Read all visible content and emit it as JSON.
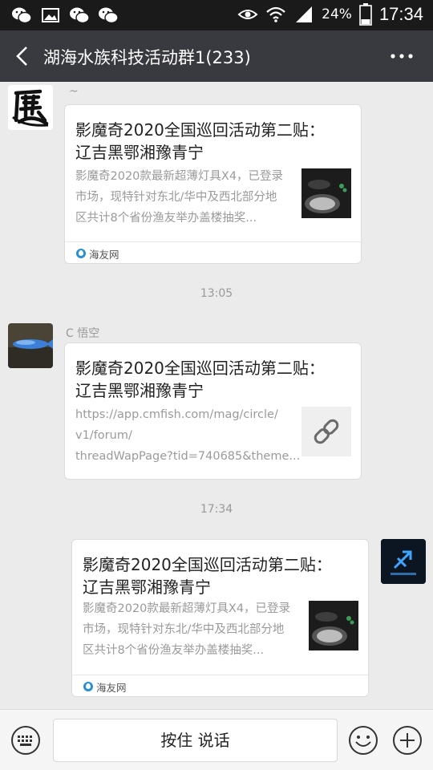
{
  "status_bar": {
    "battery": "24%",
    "time": "17:34",
    "left_icons": [
      "wechat-icon",
      "image-icon",
      "wechat-icon",
      "wechat-icon"
    ],
    "right_icons": [
      "eye-icon",
      "wifi-icon",
      "signal-icon",
      "battery-icon"
    ]
  },
  "header": {
    "title": "湖海水族科技活动群1(233)"
  },
  "messages": [
    {
      "sender": "~",
      "card": {
        "title_line1": "影魔奇2020全国巡回活动第二贴：",
        "title_line2": "辽吉黑鄂湘豫青宁",
        "desc_line1": "影魔奇2020款最新超薄灯具X4，已登录",
        "desc_line2": "市场，现特针对东北/华中及西北部分地",
        "desc_line3": "区共计8个省份渔友举办盖楼抽奖...",
        "source": "海友网"
      }
    },
    {
      "sender": "C 悟空",
      "card": {
        "title_line1": "影魔奇2020全国巡回活动第二贴：",
        "title_line2": "辽吉黑鄂湘豫青宁",
        "desc_line1": "https://app.cmfish.com/mag/circle/",
        "desc_line2": "v1/forum/",
        "desc_line3": "threadWapPage?tid=740685&theme..."
      }
    },
    {
      "sender": "",
      "card": {
        "title_line1": "影魔奇2020全国巡回活动第二贴：",
        "title_line2": "辽吉黑鄂湘豫青宁",
        "desc_line1": "影魔奇2020款最新超薄灯具X4，已登录",
        "desc_line2": "市场，现特针对东北/华中及西北部分地",
        "desc_line3": "区共计8个省份渔友举办盖楼抽奖...",
        "source": "海友网"
      }
    }
  ],
  "timestamps": [
    "13:05",
    "17:34"
  ],
  "input_bar": {
    "voice_label": "按住 说话"
  },
  "colors": {
    "status_bar_bg": "#1a1a1a",
    "header_bg": "#393a3f",
    "chat_bg": "#ebebeb",
    "source_icon": "#2a8fd0"
  }
}
